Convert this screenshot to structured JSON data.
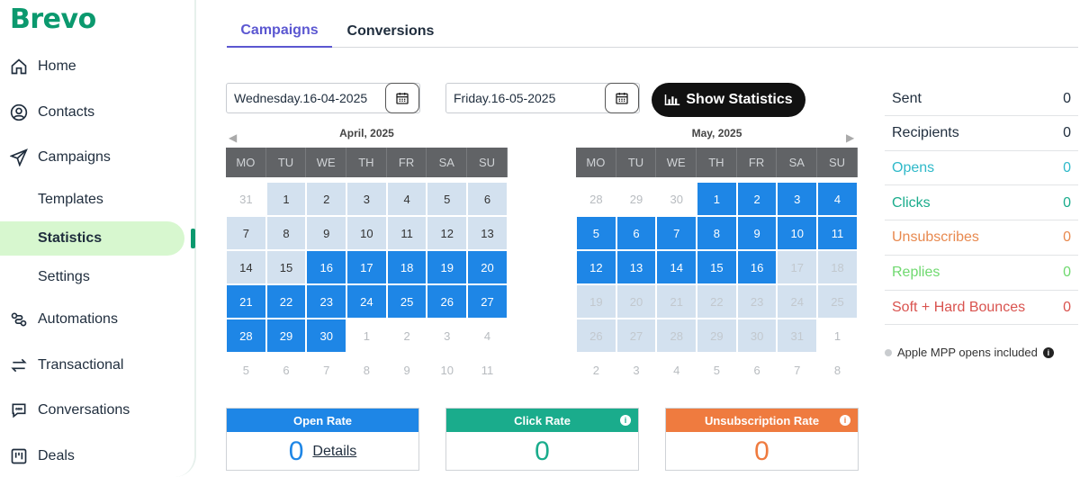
{
  "brand": "Brevo",
  "colors": {
    "brand_green": "#0b996e",
    "active_bg": "#d7f7cf",
    "tab_active": "#5b57d1",
    "selected_day": "#1e86e6",
    "open_rate": "#1e86e6",
    "click_rate": "#1aac8c",
    "unsub_rate": "#ef7b3f",
    "opens": "#2fb9c9",
    "clicks": "#1aac8c",
    "unsubscribes": "#e8894f",
    "replies": "#6fd96f",
    "bounces": "#d9534f"
  },
  "sidebar": {
    "items": [
      {
        "label": "Home",
        "icon": "home-icon"
      },
      {
        "label": "Contacts",
        "icon": "user-circle-icon"
      },
      {
        "label": "Campaigns",
        "icon": "paper-plane-icon"
      },
      {
        "label": "Templates"
      },
      {
        "label": "Statistics",
        "active": true
      },
      {
        "label": "Settings"
      },
      {
        "label": "Automations",
        "icon": "automation-icon"
      },
      {
        "label": "Transactional",
        "icon": "arrows-icon"
      },
      {
        "label": "Conversations",
        "icon": "chat-icon"
      },
      {
        "label": "Deals",
        "icon": "board-icon"
      }
    ]
  },
  "tabs": [
    {
      "label": "Campaigns",
      "active": true
    },
    {
      "label": "Conversions",
      "active": false
    }
  ],
  "date_from": "Wednesday.16-04-2025",
  "date_to": "Friday.16-05-2025",
  "show_button": "Show Statistics",
  "calendars": [
    {
      "title": "April, 2025",
      "weekdays": [
        "MO",
        "TU",
        "WE",
        "TH",
        "FR",
        "SA",
        "SU"
      ],
      "days": [
        [
          "31",
          "empty"
        ],
        [
          "1",
          "light"
        ],
        [
          "2",
          "light"
        ],
        [
          "3",
          "light"
        ],
        [
          "4",
          "light"
        ],
        [
          "5",
          "light"
        ],
        [
          "6",
          "light"
        ],
        [
          "7",
          "light"
        ],
        [
          "8",
          "light"
        ],
        [
          "9",
          "light"
        ],
        [
          "10",
          "light"
        ],
        [
          "11",
          "light"
        ],
        [
          "12",
          "light"
        ],
        [
          "13",
          "light"
        ],
        [
          "14",
          "light"
        ],
        [
          "15",
          "light"
        ],
        [
          "16",
          "sel"
        ],
        [
          "17",
          "sel"
        ],
        [
          "18",
          "sel"
        ],
        [
          "19",
          "sel"
        ],
        [
          "20",
          "sel"
        ],
        [
          "21",
          "sel"
        ],
        [
          "22",
          "sel"
        ],
        [
          "23",
          "sel"
        ],
        [
          "24",
          "sel"
        ],
        [
          "25",
          "sel"
        ],
        [
          "26",
          "sel"
        ],
        [
          "27",
          "sel"
        ],
        [
          "28",
          "sel"
        ],
        [
          "29",
          "sel"
        ],
        [
          "30",
          "sel"
        ],
        [
          "1",
          "empty"
        ],
        [
          "2",
          "empty"
        ],
        [
          "3",
          "empty"
        ],
        [
          "4",
          "empty"
        ],
        [
          "5",
          "empty"
        ],
        [
          "6",
          "empty"
        ],
        [
          "7",
          "empty"
        ],
        [
          "8",
          "empty"
        ],
        [
          "9",
          "empty"
        ],
        [
          "10",
          "empty"
        ],
        [
          "11",
          "empty"
        ]
      ]
    },
    {
      "title": "May, 2025",
      "weekdays": [
        "MO",
        "TU",
        "WE",
        "TH",
        "FR",
        "SA",
        "SU"
      ],
      "days": [
        [
          "28",
          "empty"
        ],
        [
          "29",
          "empty"
        ],
        [
          "30",
          "empty"
        ],
        [
          "1",
          "sel"
        ],
        [
          "2",
          "sel"
        ],
        [
          "3",
          "sel"
        ],
        [
          "4",
          "sel"
        ],
        [
          "5",
          "sel"
        ],
        [
          "6",
          "sel"
        ],
        [
          "7",
          "sel"
        ],
        [
          "8",
          "sel"
        ],
        [
          "9",
          "sel"
        ],
        [
          "10",
          "sel"
        ],
        [
          "11",
          "sel"
        ],
        [
          "12",
          "sel"
        ],
        [
          "13",
          "sel"
        ],
        [
          "14",
          "sel"
        ],
        [
          "15",
          "sel"
        ],
        [
          "16",
          "sel"
        ],
        [
          "17",
          "fadedbg"
        ],
        [
          "18",
          "fadedbg"
        ],
        [
          "19",
          "fadedbg"
        ],
        [
          "20",
          "fadedbg"
        ],
        [
          "21",
          "fadedbg"
        ],
        [
          "22",
          "fadedbg"
        ],
        [
          "23",
          "fadedbg"
        ],
        [
          "24",
          "fadedbg"
        ],
        [
          "25",
          "fadedbg"
        ],
        [
          "26",
          "fadedbg"
        ],
        [
          "27",
          "fadedbg"
        ],
        [
          "28",
          "fadedbg"
        ],
        [
          "29",
          "fadedbg"
        ],
        [
          "30",
          "fadedbg"
        ],
        [
          "31",
          "fadedbg"
        ],
        [
          "1",
          "empty"
        ],
        [
          "2",
          "empty"
        ],
        [
          "3",
          "empty"
        ],
        [
          "4",
          "empty"
        ],
        [
          "5",
          "empty"
        ],
        [
          "6",
          "empty"
        ],
        [
          "7",
          "empty"
        ],
        [
          "8",
          "empty"
        ]
      ]
    }
  ],
  "stats": [
    {
      "label": "Sent",
      "value": "0",
      "color": "#1f2d3d"
    },
    {
      "label": "Recipients",
      "value": "0",
      "color": "#1f2d3d"
    },
    {
      "label": "Opens",
      "value": "0",
      "color": "#2fb9c9"
    },
    {
      "label": "Clicks",
      "value": "0",
      "color": "#1aac8c"
    },
    {
      "label": "Unsubscribes",
      "value": "0",
      "color": "#e8894f"
    },
    {
      "label": "Replies",
      "value": "0",
      "color": "#6fd96f"
    },
    {
      "label": "Soft + Hard Bounces",
      "value": "0",
      "color": "#d9534f"
    }
  ],
  "mpp_note": "Apple MPP opens included",
  "rates": [
    {
      "label": "Open Rate",
      "value": "0",
      "details": "Details",
      "color": "#1e86e6",
      "value_color": "#1e86e6"
    },
    {
      "label": "Click Rate",
      "value": "0",
      "color": "#1aac8c",
      "value_color": "#1aac8c"
    },
    {
      "label": "Unsubscription Rate",
      "value": "0",
      "color": "#ef7b3f",
      "value_color": "#ef7b3f"
    }
  ]
}
